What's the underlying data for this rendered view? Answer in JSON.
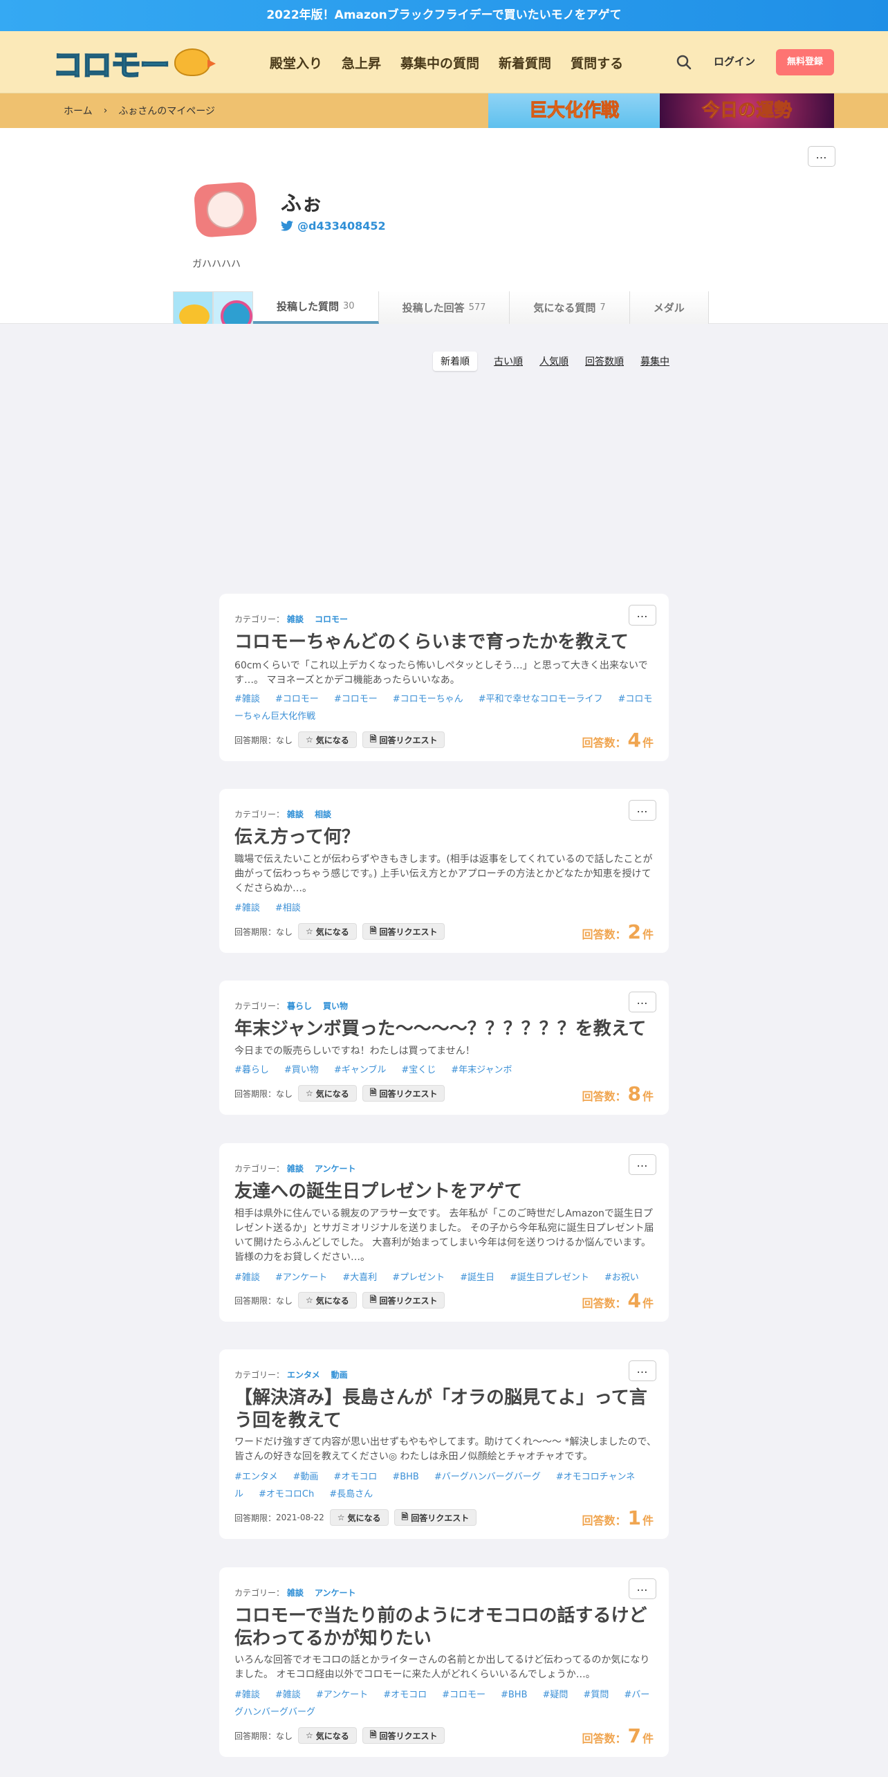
{
  "topbar": {
    "text": "2022年版！Amazonブラックフライデーで買いたいモノをアゲて"
  },
  "header": {
    "logo_text": "コロモー",
    "nav": [
      "殿堂入り",
      "急上昇",
      "募集中の質問",
      "新着質問",
      "質問する"
    ],
    "login": "ログイン",
    "signup": "無料登録"
  },
  "breadcrumb": {
    "home": "ホーム",
    "separator": "›",
    "current": "ふぉさんのマイページ"
  },
  "banners": {
    "left": "巨大化作戦",
    "right": "今日の運勢"
  },
  "profile": {
    "more": "…",
    "name": "ふぉ",
    "twitter": "@d433408452",
    "bio": "ガハハハハ"
  },
  "tabs": [
    {
      "label": "投稿した質問",
      "count": "30"
    },
    {
      "label": "投稿した回答",
      "count": "577"
    },
    {
      "label": "気になる質問",
      "count": "7"
    },
    {
      "label": "メダル",
      "count": ""
    }
  ],
  "sort": [
    "新着順",
    "古い順",
    "人気順",
    "回答数順",
    "募集中"
  ],
  "labels": {
    "category": "カテゴリー：",
    "deadline": "回答期限：",
    "watch": "気になる",
    "request": "回答リクエスト",
    "answers": "回答数：",
    "unit": "件"
  },
  "questions": [
    {
      "categories": [
        "雑談",
        "コロモー"
      ],
      "title": "コロモーちゃんどのくらいまで育ったかを教えて",
      "body": "60cmくらいで「これ以上デカくなったら怖いしペタッとしそう…」と思って大きく出来ないです…。 マヨネーズとかデコ機能あったらいいなあ。",
      "tags": [
        "#雑談",
        "#コロモー",
        "#コロモー",
        "#コロモーちゃん",
        "#平和で幸せなコロモーライフ",
        "#コロモーちゃん巨大化作戦"
      ],
      "deadline": "なし",
      "answers": "4"
    },
    {
      "categories": [
        "雑談",
        "相談"
      ],
      "title": "伝え方って何？",
      "body": "職場で伝えたいことが伝わらずやきもきします。(相手は返事をしてくれているので話したことが曲がって伝わっちゃう感じです。) 上手い伝え方とかアプローチの方法とかどなたか知恵を授けてくださらぬか…。",
      "tags": [
        "#雑談",
        "#相談"
      ],
      "deadline": "なし",
      "answers": "2"
    },
    {
      "categories": [
        "暮らし",
        "買い物"
      ],
      "title": "年末ジャンボ買った〜〜〜〜？？？？？？を教えて",
      "body": "今日までの販売らしいですね！わたしは買ってません！",
      "tags": [
        "#暮らし",
        "#買い物",
        "#ギャンブル",
        "#宝くじ",
        "#年末ジャンボ"
      ],
      "deadline": "なし",
      "answers": "8"
    },
    {
      "categories": [
        "雑談",
        "アンケート"
      ],
      "title": "友達への誕生日プレゼントをアゲて",
      "body": "相手は県外に住んでいる親友のアラサー女です。 去年私が「このご時世だしAmazonで誕生日プレゼント送るか」とサガミオリジナルを送りました。 その子から今年私宛に誕生日プレゼント届いて開けたらふんどしでした。 大喜利が始まってしまい今年は何を送りつけるか悩んでいます。 皆様の力をお貸しください…。",
      "tags": [
        "#雑談",
        "#アンケート",
        "#大喜利",
        "#プレゼント",
        "#誕生日",
        "#誕生日プレゼント",
        "#お祝い"
      ],
      "deadline": "なし",
      "answers": "4"
    },
    {
      "categories": [
        "エンタメ",
        "動画"
      ],
      "title": "【解決済み】長島さんが「オラの脳見てよ」って言う回を教えて",
      "body": "ワードだけ強すぎて内容が思い出せずもやもやしてます。助けてくれ〜〜〜 *解決しましたので、皆さんの好きな回を教えてください◎ わたしは永田ノ似顔絵とチャオチャオです。",
      "tags": [
        "#エンタメ",
        "#動画",
        "#オモコロ",
        "#BHB",
        "#バーグハンバーグバーグ",
        "#オモコロチャンネル",
        "#オモコロCh",
        "#長島さん"
      ],
      "deadline": "2021-08-22",
      "answers": "1"
    },
    {
      "categories": [
        "雑談",
        "アンケート"
      ],
      "title": "コロモーで当たり前のようにオモコロの話するけど伝わってるかが知りたい",
      "body": "いろんな回答でオモコロの話とかライターさんの名前とか出してるけど伝わってるのか気になりました。 オモコロ経由以外でコロモーに来た人がどれくらいいるんでしょうか…。",
      "tags": [
        "#雑談",
        "#雑談",
        "#アンケート",
        "#オモコロ",
        "#コロモー",
        "#BHB",
        "#疑問",
        "#質問",
        "#バーグハンバーグバーグ"
      ],
      "deadline": "なし",
      "answers": "7"
    }
  ]
}
